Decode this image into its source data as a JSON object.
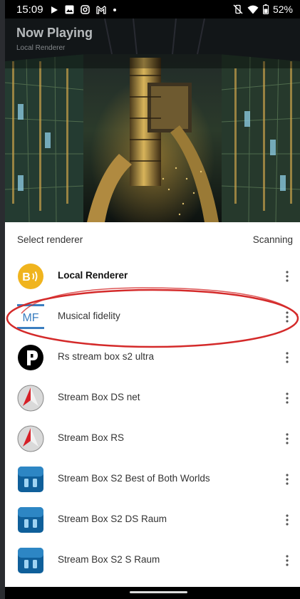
{
  "status_bar": {
    "time": "15:09",
    "battery": "52%",
    "notification_icons": [
      "play-icon",
      "image-icon",
      "instagram-icon",
      "gmail-icon",
      "dot-icon"
    ],
    "system_icons": [
      "vibrate-off-icon",
      "wifi-icon",
      "battery-icon"
    ]
  },
  "now_playing": {
    "title": "Now Playing",
    "subtitle": "Local Renderer"
  },
  "renderer_sheet": {
    "title": "Select renderer",
    "status": "Scanning",
    "items": [
      {
        "label": "Local Renderer",
        "icon": "local-renderer-icon",
        "bold": true
      },
      {
        "label": "Musical fidelity",
        "icon": "musical-fidelity-logo",
        "bold": false
      },
      {
        "label": "Rs stream box s2 ultra",
        "icon": "rs-logo-icon",
        "bold": false
      },
      {
        "label": "Stream Box DS net",
        "icon": "stream-box-ds-icon",
        "bold": false
      },
      {
        "label": "Stream Box RS",
        "icon": "stream-box-rs-icon",
        "bold": false
      },
      {
        "label": "Stream Box S2 Best of Both Worlds",
        "icon": "stream-box-s2-icon",
        "bold": false
      },
      {
        "label": "Stream Box S2 DS Raum",
        "icon": "stream-box-s2-icon",
        "bold": false
      },
      {
        "label": "Stream Box S2 S Raum",
        "icon": "stream-box-s2-icon",
        "bold": false
      }
    ]
  },
  "logos": {
    "musical_fidelity_text": "MF",
    "local_renderer_text": "B"
  },
  "colors": {
    "highlight": "#d42a2a",
    "local_renderer_icon": "#f0b41e",
    "mf_blue": "#3a7ec0",
    "stream_box_s2": "#0f5f9a",
    "sheet_background": "#ffffff"
  }
}
